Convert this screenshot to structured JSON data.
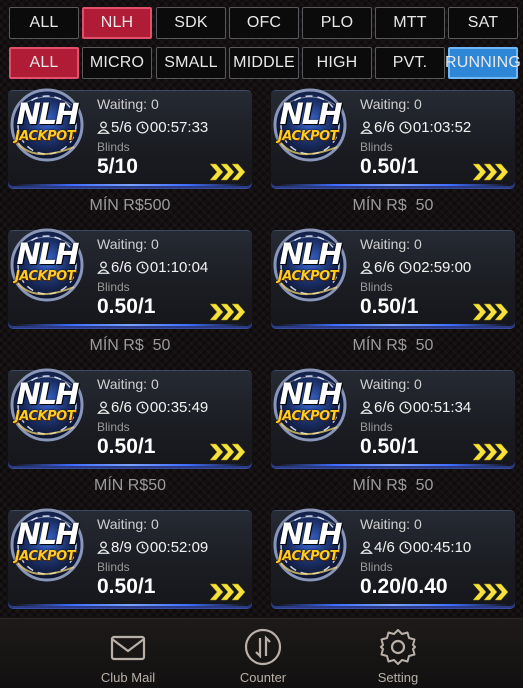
{
  "filters": {
    "game_types": [
      "ALL",
      "NLH",
      "SDK",
      "OFC",
      "PLO",
      "MTT",
      "SAT"
    ],
    "game_types_active": "NLH",
    "stakes": [
      "ALL",
      "MICRO",
      "SMALL",
      "MIDDLE",
      "HIGH",
      "PVT.",
      "RUNNING"
    ],
    "stakes_active_red": "ALL",
    "stakes_active_blue": "RUNNING"
  },
  "tables": [
    {
      "logo_main": "NLH",
      "logo_sub": "JACKPOT",
      "waiting": "Waiting: 0",
      "players": "5/6",
      "time": "00:57:33",
      "blinds_label": "Blinds",
      "blinds": "5/10",
      "min_buyin": "MÍN R$500"
    },
    {
      "logo_main": "NLH",
      "logo_sub": "JACKPOT",
      "waiting": "Waiting: 0",
      "players": "6/6",
      "time": "01:03:52",
      "blinds_label": "Blinds",
      "blinds": "0.50/1",
      "min_buyin": "MÍN R$  50"
    },
    {
      "logo_main": "NLH",
      "logo_sub": "JACKPOT",
      "waiting": "Waiting: 0",
      "players": "6/6",
      "time": "01:10:04",
      "blinds_label": "Blinds",
      "blinds": "0.50/1",
      "min_buyin": "MÍN R$  50"
    },
    {
      "logo_main": "NLH",
      "logo_sub": "JACKPOT",
      "waiting": "Waiting: 0",
      "players": "6/6",
      "time": "02:59:00",
      "blinds_label": "Blinds",
      "blinds": "0.50/1",
      "min_buyin": "MÍN R$  50"
    },
    {
      "logo_main": "NLH",
      "logo_sub": "JACKPOT",
      "waiting": "Waiting: 0",
      "players": "6/6",
      "time": "00:35:49",
      "blinds_label": "Blinds",
      "blinds": "0.50/1",
      "min_buyin": "MÍN R$50"
    },
    {
      "logo_main": "NLH",
      "logo_sub": "JACKPOT",
      "waiting": "Waiting: 0",
      "players": "6/6",
      "time": "00:51:34",
      "blinds_label": "Blinds",
      "blinds": "0.50/1",
      "min_buyin": "MÍN R$  50"
    },
    {
      "logo_main": "NLH",
      "logo_sub": "JACKPOT",
      "waiting": "Waiting: 0",
      "players": "8/9",
      "time": "00:52:09",
      "blinds_label": "Blinds",
      "blinds": "0.50/1",
      "min_buyin": ""
    },
    {
      "logo_main": "NLH",
      "logo_sub": "JACKPOT",
      "waiting": "Waiting: 0",
      "players": "4/6",
      "time": "00:45:10",
      "blinds_label": "Blinds",
      "blinds": "0.20/0.40",
      "min_buyin": ""
    }
  ],
  "icons": {
    "players": "person-icon",
    "time": "clock-icon",
    "join": "chevron-arrows-icon",
    "club_mail": "mail-icon",
    "counter": "counter-icon",
    "setting": "gear-icon"
  },
  "footer": {
    "club_mail": "Club Mail",
    "counter": "Counter",
    "setting": "Setting"
  },
  "colors": {
    "active_red": "#b01c35",
    "active_blue": "#2e86d6",
    "chevron_yellow": "#f5e23c",
    "jackpot_gold": "#ffcc22"
  }
}
